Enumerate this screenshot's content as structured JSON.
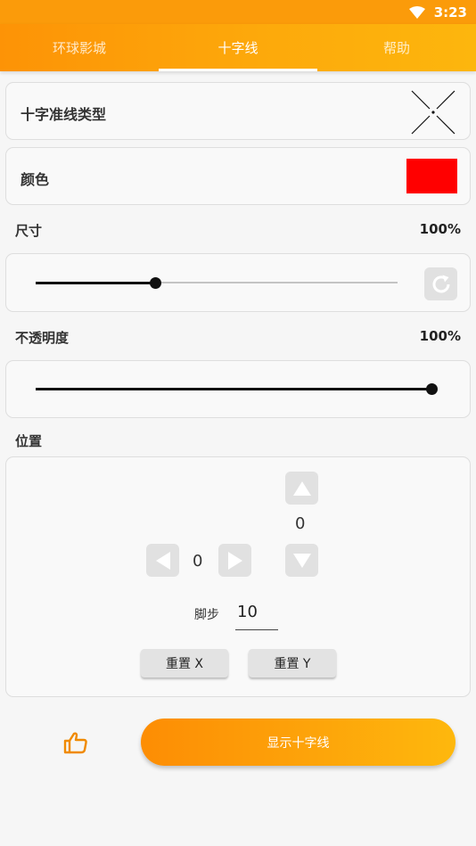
{
  "status_bar": {
    "time": "3:23",
    "icon": "wifi-icon"
  },
  "tabs": [
    {
      "label": "环球影城",
      "active": false
    },
    {
      "label": "十字线",
      "active": true
    },
    {
      "label": "帮助",
      "active": false
    }
  ],
  "crosshair_type": {
    "label": "十字准线类型",
    "icon": "crosshair-x-icon"
  },
  "color": {
    "label": "颜色",
    "value": "#ff0000"
  },
  "size": {
    "label": "尺寸",
    "value": "100%",
    "slider_fraction": 0.33,
    "reset_icon": "refresh-icon"
  },
  "opacity": {
    "label": "不透明度",
    "value": "100%",
    "slider_fraction": 1.0
  },
  "position": {
    "label": "位置",
    "x_value": "0",
    "y_value": "0",
    "step_label": "脚步",
    "step_value": "10",
    "reset_x_label": "重置 X",
    "reset_y_label": "重置 Y"
  },
  "footer": {
    "like_icon": "thumbs-up-icon",
    "show_button_label": "显示十字线"
  },
  "colors": {
    "accent": "#fd9a08",
    "accent_end": "#feb80d",
    "thumb": "#111111"
  }
}
